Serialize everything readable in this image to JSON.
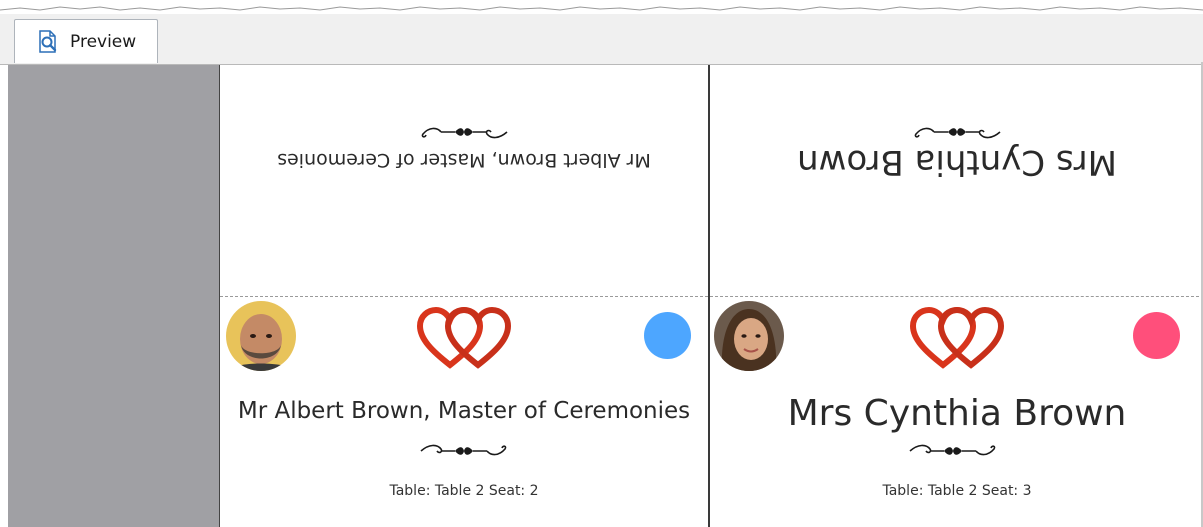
{
  "tab": {
    "label": "Preview"
  },
  "cards": [
    {
      "name": "Mr Albert Brown, Master of Ceremonies",
      "seat": "Table: Table 2 Seat: 2",
      "dot_color": "#4da6ff",
      "avatar": "bald bearded man"
    },
    {
      "name": "Mrs Cynthia Brown",
      "seat": "Table: Table 2 Seat: 3",
      "dot_color": "#ff4f7b",
      "avatar": "woman with brown hair"
    }
  ],
  "colors": {
    "heart_red": "#d9351c",
    "workspace_gray": "#a0a0a4"
  }
}
